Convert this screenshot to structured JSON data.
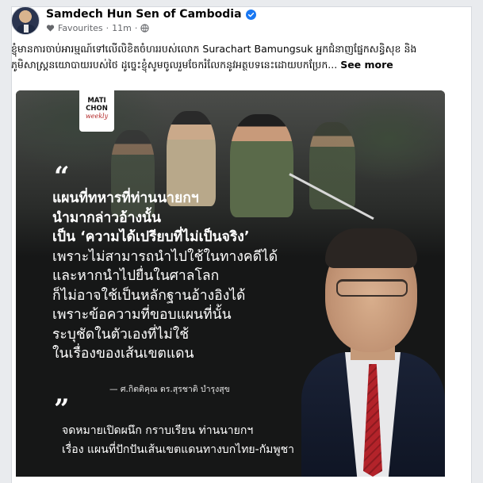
{
  "post": {
    "author": "Samdech Hun Sen of Cambodia",
    "verified_icon": "verified-badge-icon",
    "audience_label": "Favourites",
    "time": "11m",
    "separator": "·",
    "caption": "ខ្ញុំមានការចាប់អារម្មណ៍ទៅលើលិខិតចំហររបស់លោក Surachart Bamungsuk អ្នកជំនាញផ្នែកសន្ធិសុខ និងភូមិសាស្ត្រនយោបាយរបស់ថៃ ដូច្នេះខ្ញុំសូមចូលរួមចែករំលែកនូវអត្ថបទនេះដោយបកប្រែក...",
    "see_more": "See more"
  },
  "image": {
    "logo_line1": "MATI",
    "logo_line2": "CHON",
    "logo_line3": "weekly",
    "quote_open": "“",
    "quote_lines": [
      "แผนที่ทหารที่ท่านนายกฯ",
      "นำมากล่าวอ้างนั้น",
      "เป็น ‘ความได้เปรียบที่ไม่เป็นจริง’",
      "เพราะไม่สามารถนำไปใช้ในทางคดีได้",
      "และหากนำไปยื่นในศาลโลก",
      "ก็ไม่อาจใช้เป็นหลักฐานอ้างอิงได้",
      "เพราะข้อความที่ขอบแผนที่นั้น",
      "ระบุชัดในตัวเองที่ไม่ใช้",
      "ในเรื่องของเส้นเขตแดน"
    ],
    "attribution": "— ศ.กิตติคุณ ดร.สุรชาติ บำรุงสุข",
    "quote_close": "”",
    "footer_lines": [
      "จดหมายเปิดผนึก กราบเรียน ท่านนายกฯ",
      "เรื่อง แผนที่ปักปันเส้นเขตแดนทางบกไทย-กัมพูชา"
    ]
  },
  "colors": {
    "verified": "#1877f2",
    "tie": "#b3232a",
    "image_bg": "#161717"
  }
}
